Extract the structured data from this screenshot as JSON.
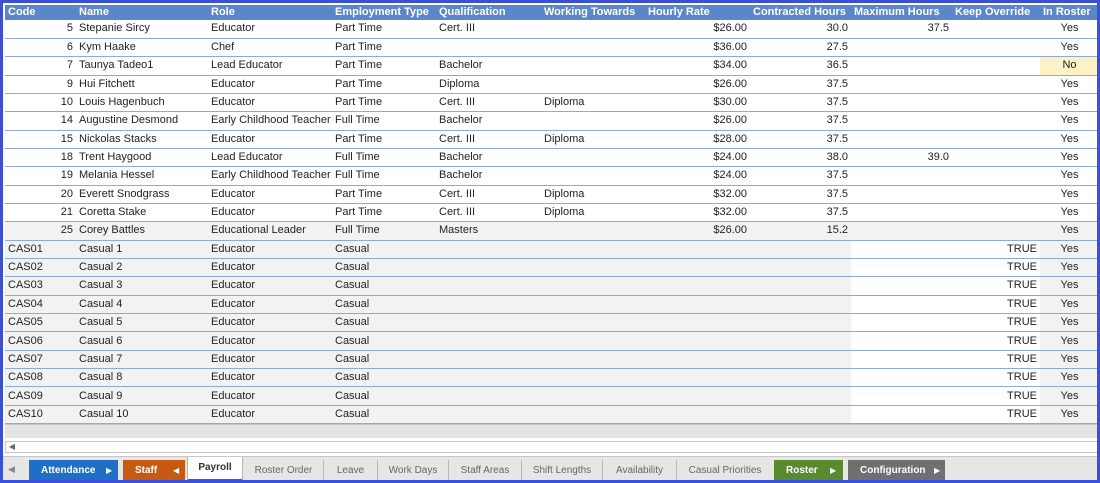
{
  "columns": [
    "Code",
    "Name",
    "Role",
    "Employment Type",
    "Qualification",
    "Working Towards",
    "Hourly Rate",
    "Contracted Hours",
    "Maximum Hours",
    "Keep Override",
    "In Roster"
  ],
  "staff_rows": [
    {
      "code": "5",
      "name": "Stepanie Sircy",
      "role": "Educator",
      "employment": "Part Time",
      "qualification": "Cert. III",
      "working_towards": "",
      "rate": "$26.00",
      "contracted": "30.0",
      "maximum": "37.5",
      "keep_override": "",
      "in_roster": "Yes"
    },
    {
      "code": "6",
      "name": "Kym Haake",
      "role": "Chef",
      "employment": "Part Time",
      "qualification": "",
      "working_towards": "",
      "rate": "$36.00",
      "contracted": "27.5",
      "maximum": "",
      "keep_override": "",
      "in_roster": "Yes"
    },
    {
      "code": "7",
      "name": "Taunya Tadeo1",
      "role": "Lead Educator",
      "employment": "Part Time",
      "qualification": "Bachelor",
      "working_towards": "",
      "rate": "$34.00",
      "contracted": "36.5",
      "maximum": "",
      "keep_override": "",
      "in_roster": "No"
    },
    {
      "code": "9",
      "name": "Hui Fitchett",
      "role": "Educator",
      "employment": "Part Time",
      "qualification": "Diploma",
      "working_towards": "",
      "rate": "$26.00",
      "contracted": "37.5",
      "maximum": "",
      "keep_override": "",
      "in_roster": "Yes"
    },
    {
      "code": "10",
      "name": "Louis Hagenbuch",
      "role": "Educator",
      "employment": "Part Time",
      "qualification": "Cert. III",
      "working_towards": "Diploma",
      "rate": "$30.00",
      "contracted": "37.5",
      "maximum": "",
      "keep_override": "",
      "in_roster": "Yes"
    },
    {
      "code": "14",
      "name": "Augustine Desmond",
      "role": "Early Childhood Teacher",
      "employment": "Full Time",
      "qualification": "Bachelor",
      "working_towards": "",
      "rate": "$26.00",
      "contracted": "37.5",
      "maximum": "",
      "keep_override": "",
      "in_roster": "Yes"
    },
    {
      "code": "15",
      "name": "Nickolas Stacks",
      "role": "Educator",
      "employment": "Part Time",
      "qualification": "Cert. III",
      "working_towards": "Diploma",
      "rate": "$28.00",
      "contracted": "37.5",
      "maximum": "",
      "keep_override": "",
      "in_roster": "Yes"
    },
    {
      "code": "18",
      "name": "Trent Haygood",
      "role": "Lead Educator",
      "employment": "Full Time",
      "qualification": "Bachelor",
      "working_towards": "",
      "rate": "$24.00",
      "contracted": "38.0",
      "maximum": "39.0",
      "keep_override": "",
      "in_roster": "Yes"
    },
    {
      "code": "19",
      "name": "Melania Hessel",
      "role": "Early Childhood Teacher",
      "employment": "Full Time",
      "qualification": "Bachelor",
      "working_towards": "",
      "rate": "$24.00",
      "contracted": "37.5",
      "maximum": "",
      "keep_override": "",
      "in_roster": "Yes"
    },
    {
      "code": "20",
      "name": "Everett Snodgrass",
      "role": "Educator",
      "employment": "Part Time",
      "qualification": "Cert. III",
      "working_towards": "Diploma",
      "rate": "$32.00",
      "contracted": "37.5",
      "maximum": "",
      "keep_override": "",
      "in_roster": "Yes"
    },
    {
      "code": "21",
      "name": "Coretta Stake",
      "role": "Educator",
      "employment": "Part Time",
      "qualification": "Cert. III",
      "working_towards": "Diploma",
      "rate": "$32.00",
      "contracted": "37.5",
      "maximum": "",
      "keep_override": "",
      "in_roster": "Yes"
    },
    {
      "code": "25",
      "name": "Corey Battles",
      "role": "Educational Leader",
      "employment": "Full Time",
      "qualification": "Masters",
      "working_towards": "",
      "rate": "$26.00",
      "contracted": "15.2",
      "maximum": "",
      "keep_override": "",
      "in_roster": "Yes"
    }
  ],
  "casual_rows": [
    {
      "code": "CAS01",
      "name": "Casual 1",
      "role": "Educator",
      "employment": "Casual",
      "keep_override": "TRUE",
      "in_roster": "Yes"
    },
    {
      "code": "CAS02",
      "name": "Casual 2",
      "role": "Educator",
      "employment": "Casual",
      "keep_override": "TRUE",
      "in_roster": "Yes"
    },
    {
      "code": "CAS03",
      "name": "Casual 3",
      "role": "Educator",
      "employment": "Casual",
      "keep_override": "TRUE",
      "in_roster": "Yes"
    },
    {
      "code": "CAS04",
      "name": "Casual 4",
      "role": "Educator",
      "employment": "Casual",
      "keep_override": "TRUE",
      "in_roster": "Yes"
    },
    {
      "code": "CAS05",
      "name": "Casual 5",
      "role": "Educator",
      "employment": "Casual",
      "keep_override": "TRUE",
      "in_roster": "Yes"
    },
    {
      "code": "CAS06",
      "name": "Casual 6",
      "role": "Educator",
      "employment": "Casual",
      "keep_override": "TRUE",
      "in_roster": "Yes"
    },
    {
      "code": "CAS07",
      "name": "Casual 7",
      "role": "Educator",
      "employment": "Casual",
      "keep_override": "TRUE",
      "in_roster": "Yes"
    },
    {
      "code": "CAS08",
      "name": "Casual 8",
      "role": "Educator",
      "employment": "Casual",
      "keep_override": "TRUE",
      "in_roster": "Yes"
    },
    {
      "code": "CAS09",
      "name": "Casual 9",
      "role": "Educator",
      "employment": "Casual",
      "keep_override": "TRUE",
      "in_roster": "Yes"
    },
    {
      "code": "CAS10",
      "name": "Casual 10",
      "role": "Educator",
      "employment": "Casual",
      "keep_override": "TRUE",
      "in_roster": "Yes"
    }
  ],
  "sheet_tabs": {
    "attendance": "Attendance",
    "staff": "Staff",
    "payroll": "Payroll",
    "roster_order": "Roster Order",
    "leave": "Leave",
    "work_days": "Work Days",
    "staff_areas": "Staff Areas",
    "shift_lengths": "Shift Lengths",
    "availability": "Availability",
    "casual_priorities": "Casual Priorities",
    "roster": "Roster",
    "configuration": "Configuration"
  },
  "colors": {
    "frame_border": "#3a50d9",
    "header_bg": "#5b86c9",
    "attendance_tab": "#1f6fc5",
    "staff_tab": "#c65a10",
    "roster_tab": "#5a8a30",
    "configuration_tab": "#707070",
    "highlight_no": "#fdf1c7"
  },
  "icons": {
    "scroll_left": "triangle-left-icon",
    "tab_arrow_right": "triangle-right-icon",
    "tab_arrow_left": "triangle-left-icon"
  }
}
